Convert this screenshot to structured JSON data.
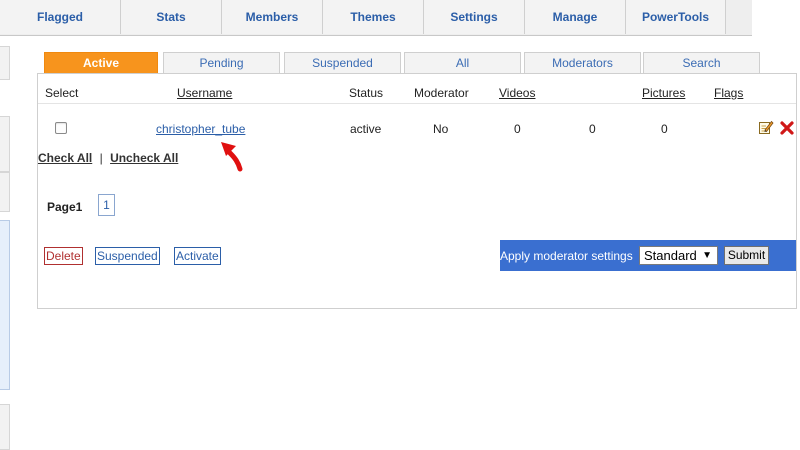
{
  "nav": {
    "items": [
      {
        "label": "Flagged"
      },
      {
        "label": "Stats"
      },
      {
        "label": "Members"
      },
      {
        "label": "Themes"
      },
      {
        "label": "Settings"
      },
      {
        "label": "Manage"
      },
      {
        "label": "PowerTools"
      }
    ]
  },
  "tabs": [
    {
      "label": "Active"
    },
    {
      "label": "Pending"
    },
    {
      "label": "Suspended"
    },
    {
      "label": "All"
    },
    {
      "label": "Moderators"
    },
    {
      "label": "Search"
    }
  ],
  "table": {
    "columns": {
      "select": "Select",
      "username": "Username",
      "status": "Status",
      "moderator": "Moderator",
      "videos": "Videos",
      "pictures": "Pictures",
      "flags": "Flags"
    },
    "rows": [
      {
        "username": "christopher_tube",
        "status": "active",
        "moderator": "No",
        "videos": "0",
        "col5": "0",
        "pictures": "0"
      }
    ]
  },
  "selection": {
    "check_all": "Check All",
    "separator": "|",
    "uncheck_all": "Uncheck All"
  },
  "pagination": {
    "label": "Page1",
    "pages": [
      "1"
    ]
  },
  "actions": {
    "delete": "Delete",
    "suspended": "Suspended",
    "activate": "Activate"
  },
  "moderator_bar": {
    "label": "Apply moderator settings",
    "selected": "Standard",
    "submit": "Submit"
  },
  "colors": {
    "active_tab": "#f7941d",
    "link_blue": "#2b5ea8",
    "moderator_bar": "#3a6fd0",
    "delete_red": "#b03030",
    "annotation_arrow": "#e01010"
  },
  "icons": [
    "edit-icon",
    "delete-x-icon",
    "annotation-arrow-icon"
  ]
}
